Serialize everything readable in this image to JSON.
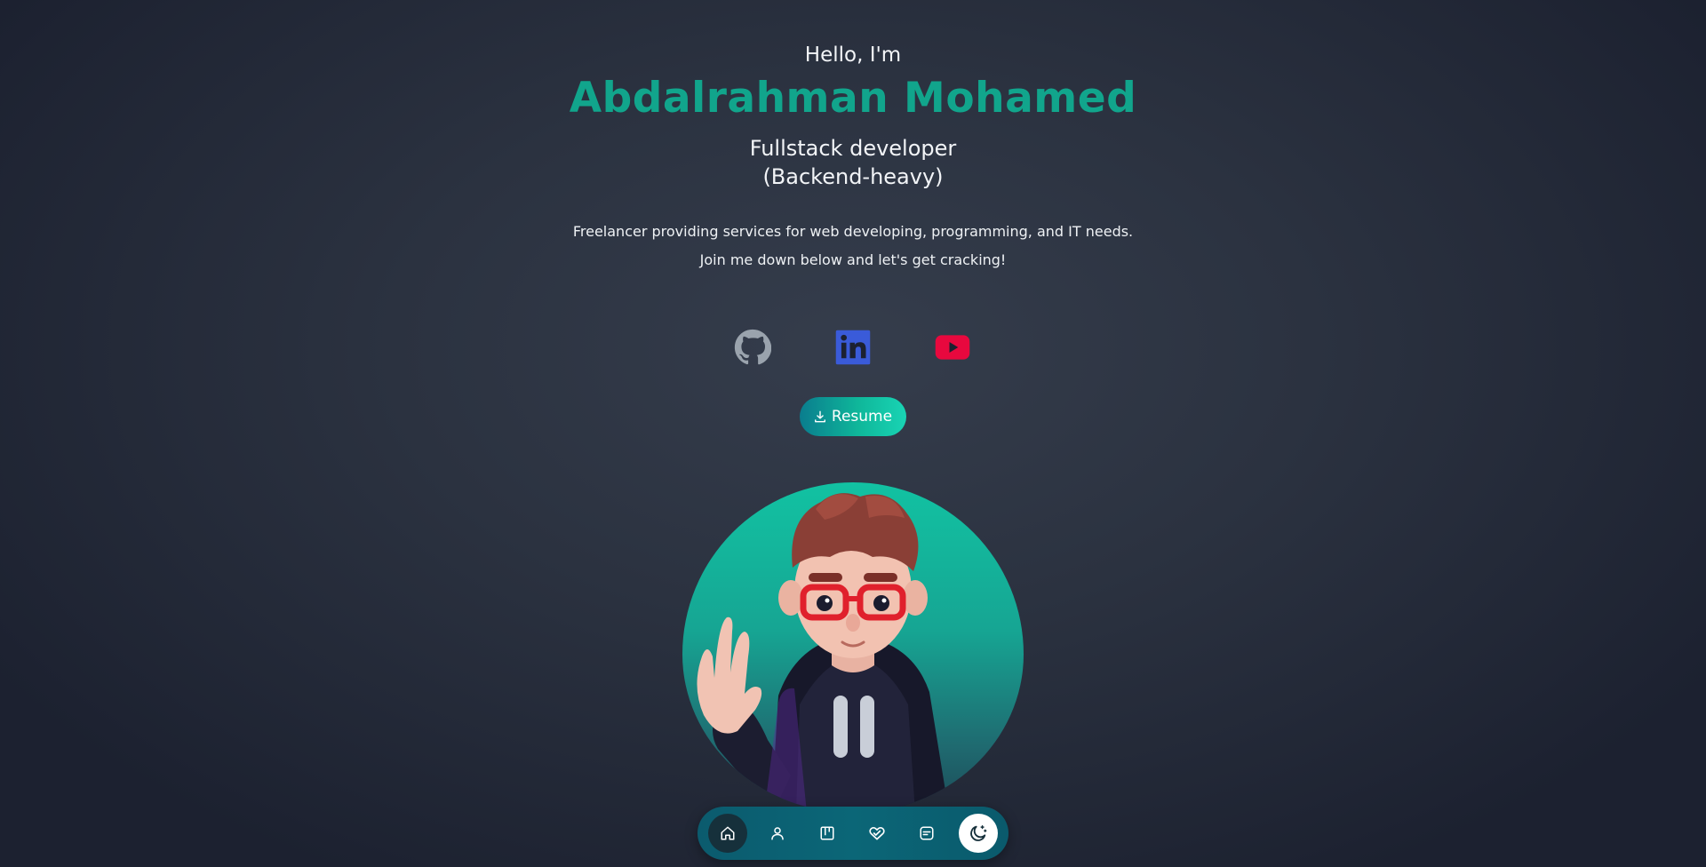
{
  "hero": {
    "greeting": "Hello, I'm",
    "name": "Abdalrahman Mohamed",
    "role_line1": "Fullstack developer",
    "role_line2": "(Backend-heavy)",
    "description_line1": "Freelancer providing services for web developing, programming, and IT needs.",
    "description_line2": "Join me down below and let's get cracking!"
  },
  "socials": [
    {
      "icon": "github-icon",
      "color": "#9aa3ad"
    },
    {
      "icon": "linkedin-icon",
      "color": "#3a5bd9"
    },
    {
      "icon": "youtube-icon",
      "color": "#e8083e"
    }
  ],
  "resume": {
    "label": "Resume",
    "icon": "download-icon"
  },
  "avatar": {
    "description_icon": "avatar-illustration"
  },
  "navbar": {
    "items": [
      {
        "icon": "home-icon",
        "active": true
      },
      {
        "icon": "user-icon",
        "active": false
      },
      {
        "icon": "portfolio-icon",
        "active": false
      },
      {
        "icon": "services-icon",
        "active": false
      },
      {
        "icon": "contact-icon",
        "active": false
      },
      {
        "icon": "moon-icon",
        "active": false
      }
    ]
  },
  "colors": {
    "accent": "#11a58c",
    "background": "#2b3240",
    "navbar": "#0b6677"
  }
}
